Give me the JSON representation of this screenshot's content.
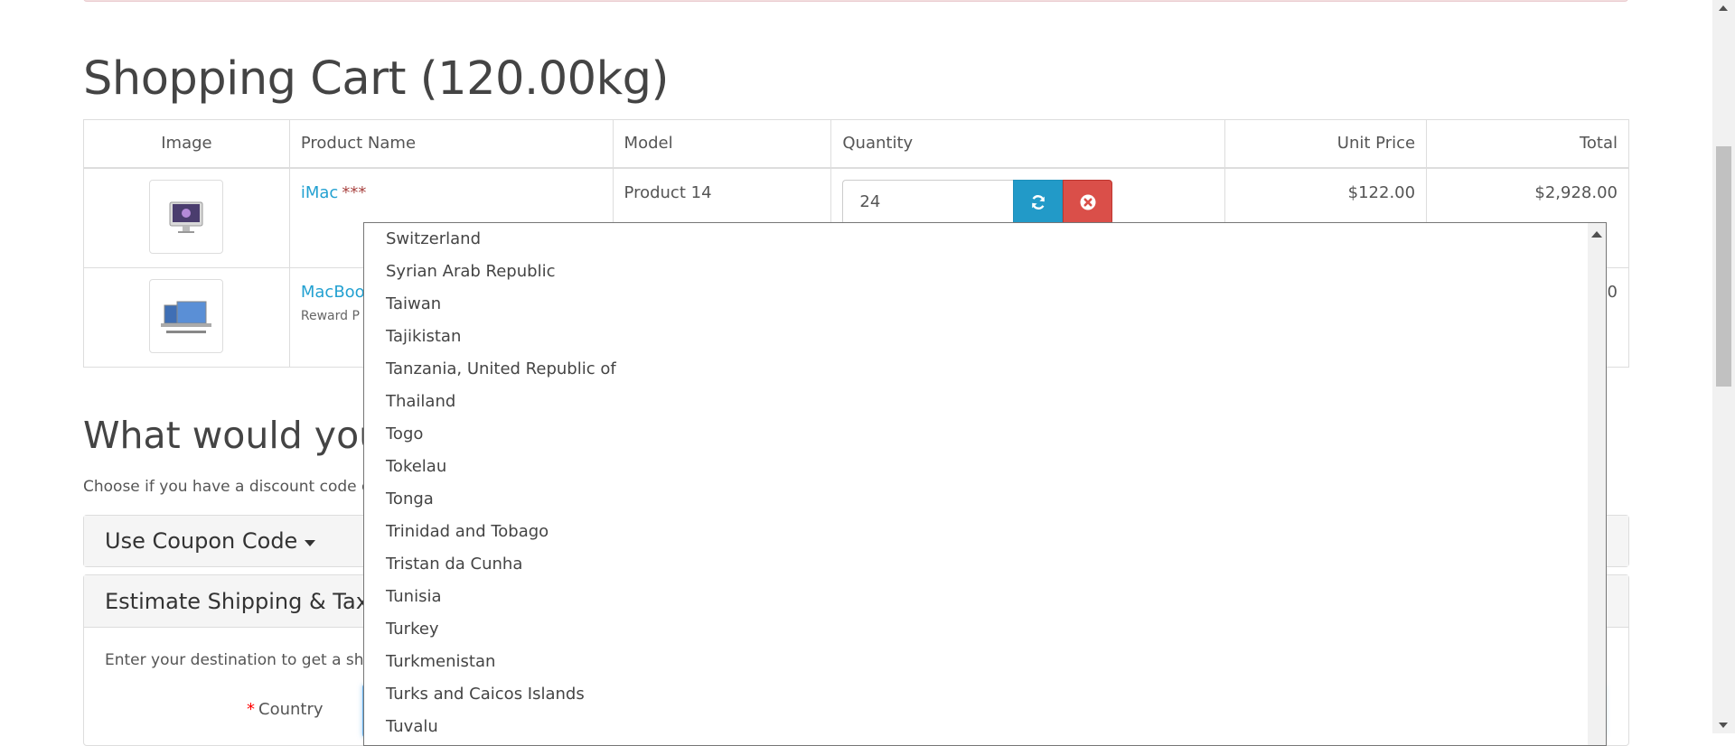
{
  "page": {
    "title": "Shopping Cart  (120.00kg)",
    "accent_color": "#23a1d1",
    "refresh_color": "#229ac8",
    "remove_color": "#da4f49"
  },
  "cart": {
    "headers": [
      "Image",
      "Product Name",
      "Model",
      "Quantity",
      "Unit Price",
      "Total"
    ],
    "rows": [
      {
        "image_icon": "imac-thumbnail",
        "name": "iMac",
        "stock_flag": "***",
        "model": "Product 14",
        "quantity": "24",
        "unit_price": "$122.00",
        "total": "$2,928.00"
      },
      {
        "image_icon": "macbook-thumbnail",
        "name": "MacBoo",
        "reward_fragment": "Reward P",
        "total_fragment": "0"
      }
    ],
    "refresh_icon": "refresh-icon",
    "remove_icon": "remove-circle-icon"
  },
  "next_section": {
    "title_fragment": "What would you",
    "desc_fragment": "Choose if you have a discount code o"
  },
  "coupon_panel": {
    "title": "Use Coupon Code"
  },
  "shipping_panel": {
    "title_fragment": "Estimate Shipping & Taxes",
    "desc_fragment": "Enter your destination to get a ship",
    "country_label": "Country",
    "required_mark": "*"
  },
  "country_dropdown": {
    "options": [
      "Switzerland",
      "Syrian Arab Republic",
      "Taiwan",
      "Tajikistan",
      "Tanzania, United Republic of",
      "Thailand",
      "Togo",
      "Tokelau",
      "Tonga",
      "Trinidad and Tobago",
      "Tristan da Cunha",
      "Tunisia",
      "Turkey",
      "Turkmenistan",
      "Turks and Caicos Islands",
      "Tuvalu"
    ]
  }
}
